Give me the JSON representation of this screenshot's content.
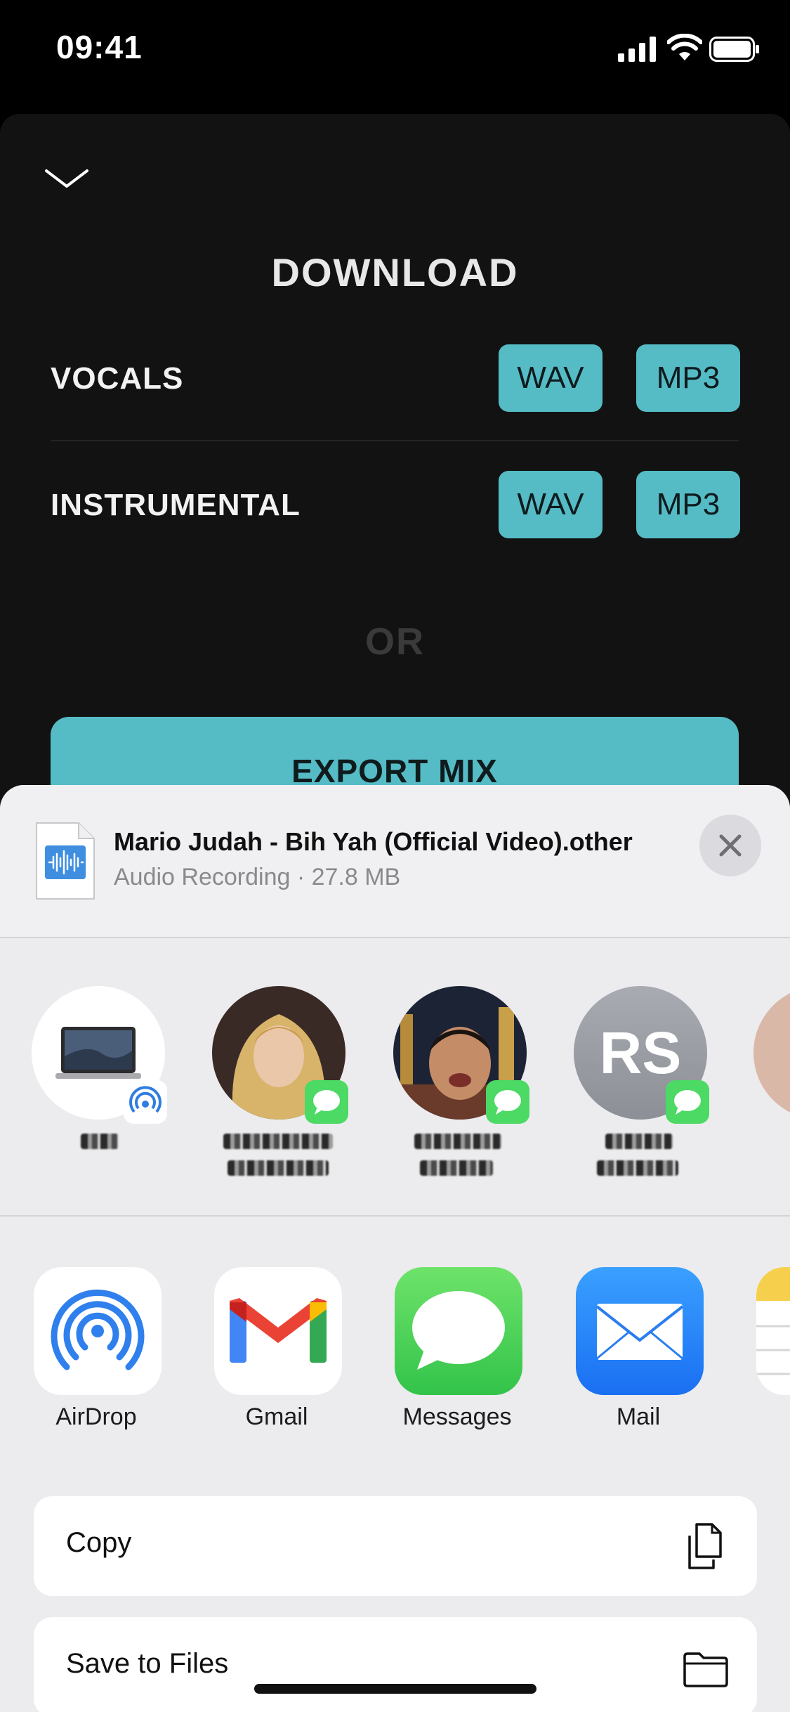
{
  "status_bar": {
    "time": "09:41"
  },
  "download": {
    "title": "DOWNLOAD",
    "rows": [
      {
        "label": "VOCALS",
        "wav": "WAV",
        "mp3": "MP3"
      },
      {
        "label": "INSTRUMENTAL",
        "wav": "WAV",
        "mp3": "MP3"
      }
    ],
    "or_label": "OR",
    "export_label": "EXPORT MIX",
    "accent_color": "#55bcc6"
  },
  "share": {
    "file_name": "Mario Judah - Bih Yah (Official Video).other",
    "file_meta": "Audio Recording · 27.8 MB",
    "contacts": [
      {
        "initials": "",
        "kind": "airdrop-device"
      },
      {
        "initials": "",
        "kind": "message"
      },
      {
        "initials": "",
        "kind": "message"
      },
      {
        "initials": "RS",
        "kind": "message"
      }
    ],
    "apps": [
      {
        "label": "AirDrop",
        "icon": "airdrop-icon"
      },
      {
        "label": "Gmail",
        "icon": "gmail-icon"
      },
      {
        "label": "Messages",
        "icon": "messages-icon"
      },
      {
        "label": "Mail",
        "icon": "mail-icon"
      }
    ],
    "actions": [
      {
        "label": "Copy",
        "icon": "copy-icon"
      },
      {
        "label": "Save to Files",
        "icon": "folder-icon"
      }
    ]
  }
}
